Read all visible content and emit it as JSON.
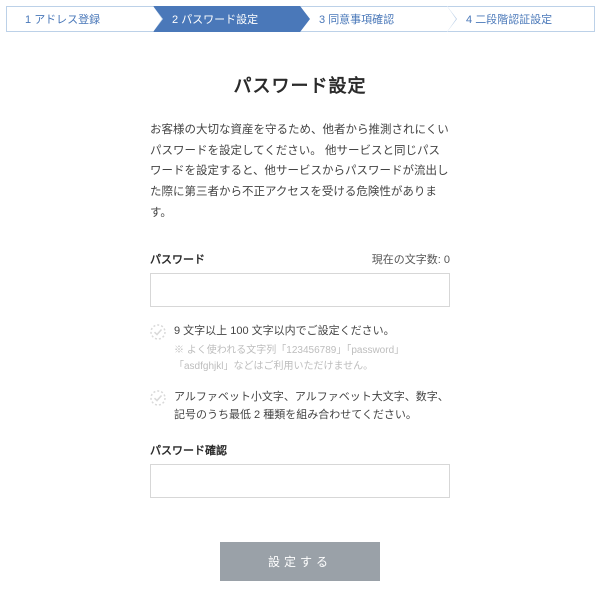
{
  "stepper": {
    "items": [
      {
        "num": "1",
        "label": "アドレス登録"
      },
      {
        "num": "2",
        "label": "パスワード設定"
      },
      {
        "num": "3",
        "label": "同意事項確認"
      },
      {
        "num": "4",
        "label": "二段階認証設定"
      }
    ],
    "activeIndex": 1
  },
  "title": "パスワード設定",
  "intro": "お客様の大切な資産を守るため、他者から推測されにくいパスワードを設定してください。 他サービスと同じパスワードを設定すると、他サービスからパスワードが流出した際に第三者から不正アクセスを受ける危険性があります。",
  "password": {
    "label": "パスワード",
    "counter_prefix": "現在の文字数: ",
    "counter_value": "0",
    "value": ""
  },
  "rules": [
    {
      "text": "9 文字以上 100 文字以内でご設定ください。",
      "note": "※ よく使われる文字列「123456789」「password」「asdfghjkl」などはご利用いただけません。"
    },
    {
      "text": "アルファベット小文字、アルファベット大文字、数字、記号のうち最低 2 種類を組み合わせてください。",
      "note": ""
    }
  ],
  "confirm": {
    "label": "パスワード確認",
    "value": ""
  },
  "submit": {
    "label": "設定する"
  }
}
